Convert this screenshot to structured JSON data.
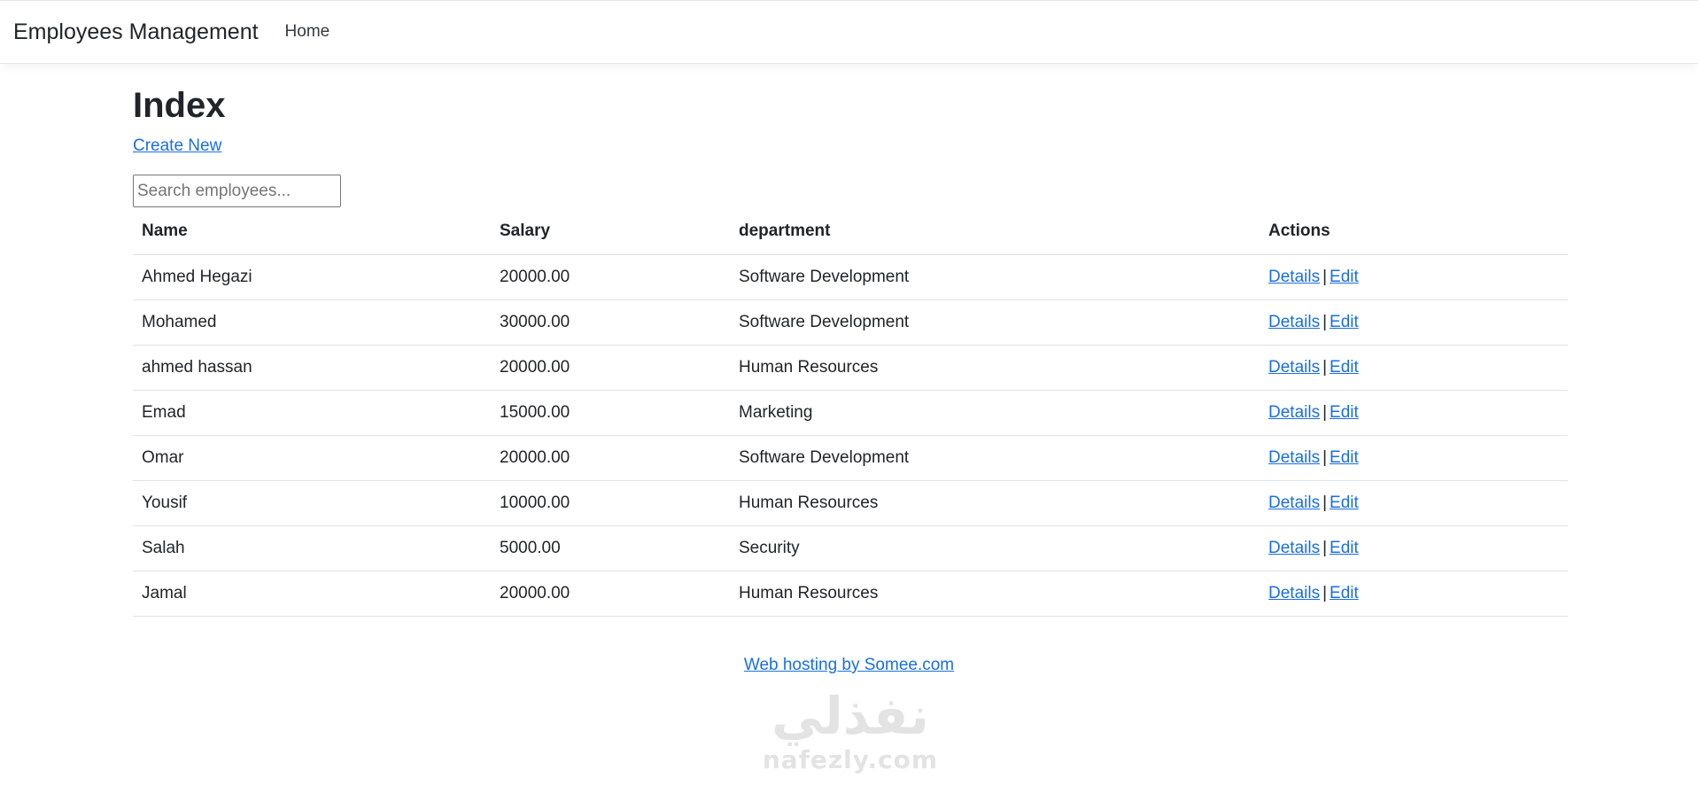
{
  "navbar": {
    "brand": "Employees Management",
    "links": [
      "Home"
    ]
  },
  "page": {
    "title": "Index",
    "create_new": "Create New"
  },
  "search": {
    "placeholder": "Search employees...",
    "value": ""
  },
  "table": {
    "headers": [
      "Name",
      "Salary",
      "department",
      "Actions"
    ],
    "rows": [
      {
        "name": "Ahmed Hegazi",
        "salary": "20000.00",
        "department": "Software Development"
      },
      {
        "name": "Mohamed",
        "salary": "30000.00",
        "department": "Software Development"
      },
      {
        "name": "ahmed hassan",
        "salary": "20000.00",
        "department": "Human Resources"
      },
      {
        "name": "Emad",
        "salary": "15000.00",
        "department": "Marketing"
      },
      {
        "name": "Omar",
        "salary": "20000.00",
        "department": "Software Development"
      },
      {
        "name": "Yousif",
        "salary": "10000.00",
        "department": "Human Resources"
      },
      {
        "name": "Salah",
        "salary": "5000.00",
        "department": "Security"
      },
      {
        "name": "Jamal",
        "salary": "20000.00",
        "department": "Human Resources"
      }
    ],
    "actions": {
      "details": "Details",
      "separator": "|",
      "edit": "Edit"
    }
  },
  "footer": {
    "hosting_link": "Web hosting by Somee.com"
  },
  "watermark": {
    "arabic": "نفذلي",
    "latin": "nafezly.com"
  },
  "colors": {
    "link": "#1a6fe0",
    "text": "#212529",
    "border": "#dee2e6"
  }
}
